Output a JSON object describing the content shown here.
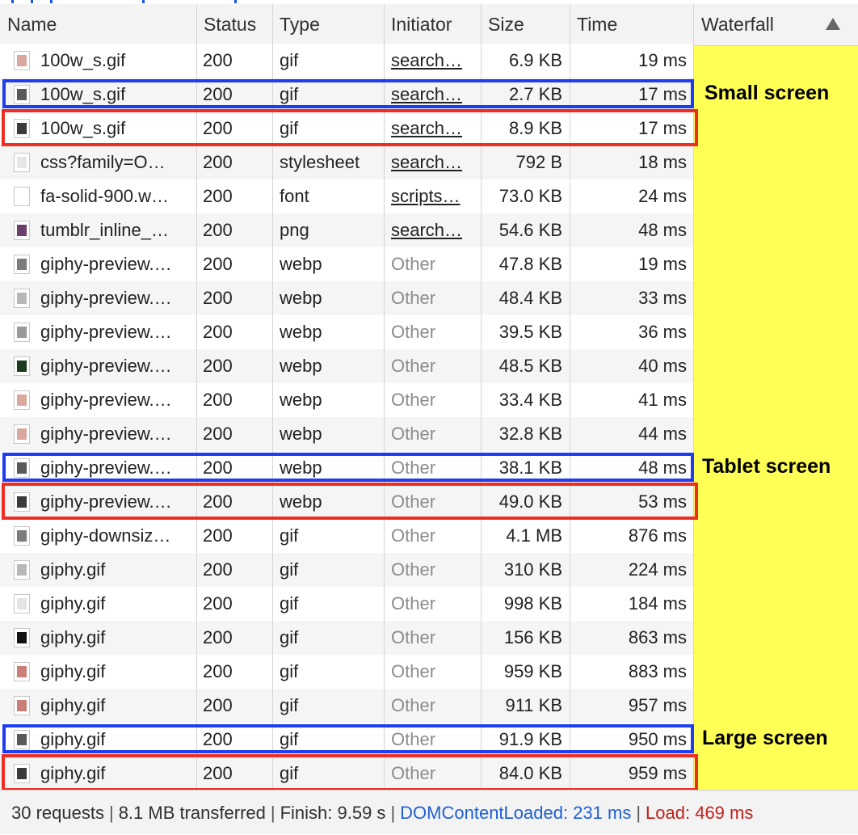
{
  "columns": {
    "name": "Name",
    "status": "Status",
    "type": "Type",
    "initiator": "Initiator",
    "size": "Size",
    "time": "Time",
    "waterfall": "Waterfall"
  },
  "rows": [
    {
      "name": "100w_s.gif",
      "status": "200",
      "type": "gif",
      "initiator": "search…",
      "initiator_kind": "link",
      "size": "6.9 KB",
      "time": "19 ms",
      "icon": "image-thumb-icon",
      "icon_color": "#d9a79d"
    },
    {
      "name": "100w_s.gif",
      "status": "200",
      "type": "gif",
      "initiator": "search…",
      "initiator_kind": "link",
      "size": "2.7 KB",
      "time": "17 ms",
      "icon": "image-thumb-icon",
      "icon_color": "#5a5a5a"
    },
    {
      "name": "100w_s.gif",
      "status": "200",
      "type": "gif",
      "initiator": "search…",
      "initiator_kind": "link",
      "size": "8.9 KB",
      "time": "17 ms",
      "icon": "image-thumb-icon",
      "icon_color": "#3a3a3a"
    },
    {
      "name": "css?family=O…",
      "status": "200",
      "type": "stylesheet",
      "initiator": "search…",
      "initiator_kind": "link",
      "size": "792 B",
      "time": "18 ms",
      "icon": "document-icon",
      "icon_color": "#e6e6e6"
    },
    {
      "name": "fa-solid-900.w…",
      "status": "200",
      "type": "font",
      "initiator": "scripts…",
      "initiator_kind": "link",
      "size": "73.0 KB",
      "time": "24 ms",
      "icon": "blank-file-icon",
      "icon_color": "#ffffff"
    },
    {
      "name": "tumblr_inline_…",
      "status": "200",
      "type": "png",
      "initiator": "search…",
      "initiator_kind": "link",
      "size": "54.6 KB",
      "time": "48 ms",
      "icon": "image-thumb-icon",
      "icon_color": "#6b3e6b"
    },
    {
      "name": "giphy-preview.…",
      "status": "200",
      "type": "webp",
      "initiator": "Other",
      "initiator_kind": "other",
      "size": "47.8 KB",
      "time": "19 ms",
      "icon": "image-thumb-icon",
      "icon_color": "#7c7c7c"
    },
    {
      "name": "giphy-preview.…",
      "status": "200",
      "type": "webp",
      "initiator": "Other",
      "initiator_kind": "other",
      "size": "48.4 KB",
      "time": "33 ms",
      "icon": "image-thumb-icon",
      "icon_color": "#b8b8b8"
    },
    {
      "name": "giphy-preview.…",
      "status": "200",
      "type": "webp",
      "initiator": "Other",
      "initiator_kind": "other",
      "size": "39.5 KB",
      "time": "36 ms",
      "icon": "image-thumb-icon",
      "icon_color": "#9a9a9a"
    },
    {
      "name": "giphy-preview.…",
      "status": "200",
      "type": "webp",
      "initiator": "Other",
      "initiator_kind": "other",
      "size": "48.5 KB",
      "time": "40 ms",
      "icon": "image-thumb-icon",
      "icon_color": "#1c3b1c"
    },
    {
      "name": "giphy-preview.…",
      "status": "200",
      "type": "webp",
      "initiator": "Other",
      "initiator_kind": "other",
      "size": "33.4 KB",
      "time": "41 ms",
      "icon": "image-thumb-icon",
      "icon_color": "#d9a79d"
    },
    {
      "name": "giphy-preview.…",
      "status": "200",
      "type": "webp",
      "initiator": "Other",
      "initiator_kind": "other",
      "size": "32.8 KB",
      "time": "44 ms",
      "icon": "image-thumb-icon",
      "icon_color": "#d9a79d"
    },
    {
      "name": "giphy-preview.…",
      "status": "200",
      "type": "webp",
      "initiator": "Other",
      "initiator_kind": "other",
      "size": "38.1 KB",
      "time": "48 ms",
      "icon": "image-thumb-icon",
      "icon_color": "#5a5a5a"
    },
    {
      "name": "giphy-preview.…",
      "status": "200",
      "type": "webp",
      "initiator": "Other",
      "initiator_kind": "other",
      "size": "49.0 KB",
      "time": "53 ms",
      "icon": "image-thumb-icon",
      "icon_color": "#3a3a3a"
    },
    {
      "name": "giphy-downsiz…",
      "status": "200",
      "type": "gif",
      "initiator": "Other",
      "initiator_kind": "other",
      "size": "4.1 MB",
      "time": "876 ms",
      "icon": "image-thumb-icon",
      "icon_color": "#7c7c7c"
    },
    {
      "name": "giphy.gif",
      "status": "200",
      "type": "gif",
      "initiator": "Other",
      "initiator_kind": "other",
      "size": "310 KB",
      "time": "224 ms",
      "icon": "image-thumb-icon",
      "icon_color": "#b8b8b8"
    },
    {
      "name": "giphy.gif",
      "status": "200",
      "type": "gif",
      "initiator": "Other",
      "initiator_kind": "other",
      "size": "998 KB",
      "time": "184 ms",
      "icon": "image-thumb-icon",
      "icon_color": "#e4e4e4"
    },
    {
      "name": "giphy.gif",
      "status": "200",
      "type": "gif",
      "initiator": "Other",
      "initiator_kind": "other",
      "size": "156 KB",
      "time": "863 ms",
      "icon": "image-thumb-icon",
      "icon_color": "#111111"
    },
    {
      "name": "giphy.gif",
      "status": "200",
      "type": "gif",
      "initiator": "Other",
      "initiator_kind": "other",
      "size": "959 KB",
      "time": "883 ms",
      "icon": "image-thumb-icon",
      "icon_color": "#c97f77"
    },
    {
      "name": "giphy.gif",
      "status": "200",
      "type": "gif",
      "initiator": "Other",
      "initiator_kind": "other",
      "size": "911 KB",
      "time": "957 ms",
      "icon": "image-thumb-icon",
      "icon_color": "#c97f77"
    },
    {
      "name": "giphy.gif",
      "status": "200",
      "type": "gif",
      "initiator": "Other",
      "initiator_kind": "other",
      "size": "91.9 KB",
      "time": "950 ms",
      "icon": "image-thumb-icon",
      "icon_color": "#5a5a5a"
    },
    {
      "name": "giphy.gif",
      "status": "200",
      "type": "gif",
      "initiator": "Other",
      "initiator_kind": "other",
      "size": "84.0 KB",
      "time": "959 ms",
      "icon": "image-thumb-icon",
      "icon_color": "#3a3a3a"
    }
  ],
  "highlight_groups": [
    {
      "label": "Small screen",
      "blue_row": 1,
      "red_row": 2
    },
    {
      "label": "Tablet screen",
      "blue_row": 12,
      "red_row": 13
    },
    {
      "label": "Large screen",
      "blue_row": 20,
      "red_row": 21
    }
  ],
  "footer": {
    "requests": "30 requests",
    "transferred": "8.1 MB transferred",
    "finish": "Finish: 9.59 s",
    "domcontentloaded": "DOMContentLoaded: 231 ms",
    "load": "Load: 469 ms"
  },
  "colors": {
    "waterfall_bg": "#ffff55",
    "blue_box": "#1e3df0",
    "red_box": "#ee2e24",
    "dcl_text": "#1f5fd6",
    "load_text": "#c0201a"
  }
}
